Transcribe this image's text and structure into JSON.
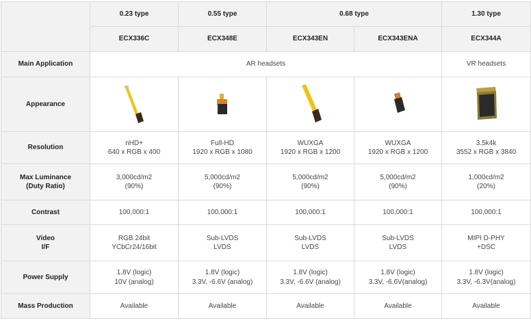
{
  "types": {
    "t023": "0.23 type",
    "t055": "0.55 type",
    "t068": "0.68 type",
    "t130": "1.30 type"
  },
  "models": [
    "ECX336C",
    "ECX348E",
    "ECX343EN",
    "ECX343ENA",
    "ECX344A"
  ],
  "rows": {
    "main_application": "Main Application",
    "appearance": "Appearance",
    "resolution": "Resolution",
    "max_luminance": [
      "Max Luminance",
      "(Duty Ratio)"
    ],
    "contrast": "Contrast",
    "video_if": [
      "Video",
      "I/F"
    ],
    "power_supply": "Power Supply",
    "mass_production": "Mass Production"
  },
  "applications": {
    "ar": "AR headsets",
    "vr": "VR headsets"
  },
  "appearance_icons": [
    "flex-cable-display-icon",
    "small-display-module-icon",
    "flex-cable-display-icon",
    "small-display-module-icon",
    "large-display-module-icon"
  ],
  "resolution": [
    [
      "nHD+",
      "640 x RGB x 400"
    ],
    [
      "Full-HD",
      "1920 x RGB x 1080"
    ],
    [
      "WUXGA",
      "1920 x RGB x 1200"
    ],
    [
      "WUXGA",
      "1920 x RGB x 1200"
    ],
    [
      "3.5k4k",
      "3552 x RGB x 3840"
    ]
  ],
  "luminance": [
    [
      "3,000cd/m2",
      "(90%)"
    ],
    [
      "5,000cd/m2",
      "(90%)"
    ],
    [
      "5,000cd/m2",
      "(90%)"
    ],
    [
      "5,000cd/m2",
      "(90%)"
    ],
    [
      "1,000cd/m2",
      "(20%)"
    ]
  ],
  "contrast": [
    "100,000:1",
    "100,000:1",
    "100,000:1",
    "100,000:1",
    "100,000:1"
  ],
  "video_if": [
    [
      "RGB 24bit",
      "YCbCr24/16bit"
    ],
    [
      "Sub-LVDS",
      "LVDS"
    ],
    [
      "Sub-LVDS",
      "LVDS"
    ],
    [
      "Sub-LVDS",
      "LVDS"
    ],
    [
      "MIPI D-PHY",
      "+DSC"
    ]
  ],
  "power_supply": [
    [
      "1.8V (logic)",
      "10V (analog)"
    ],
    [
      "1.8V (logic)",
      "3.3V, -6.6V (analog)"
    ],
    [
      "1.8V (logic)",
      "3.3V, -6.6V (analog)"
    ],
    [
      "1.8V (logic)",
      "3.3V, -6.6V(analog)"
    ],
    [
      "1.8V (logic)",
      "3.3V, -6.3V(analog)"
    ]
  ],
  "mass_production": [
    "Available",
    "Available",
    "Available",
    "Available",
    "Available"
  ],
  "colors": {
    "header_bg": "#f2f2f2",
    "border": "#d9d9d9",
    "flex_yellow": "#f2c21a",
    "module_orange": "#d9812a",
    "module_dark": "#2a2a2a"
  }
}
